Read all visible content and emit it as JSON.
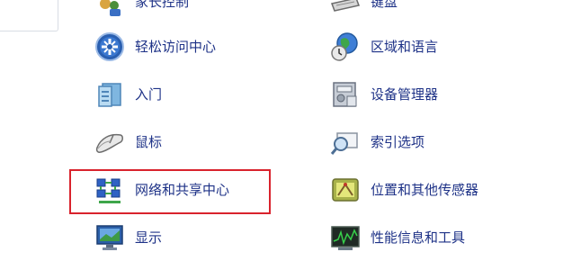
{
  "left_column": [
    {
      "label": "家长控制",
      "icon": "parental-controls-icon"
    },
    {
      "label": "轻松访问中心",
      "icon": "ease-of-access-icon"
    },
    {
      "label": "入门",
      "icon": "getting-started-icon"
    },
    {
      "label": "鼠标",
      "icon": "mouse-icon"
    },
    {
      "label": "网络和共享中心",
      "icon": "network-sharing-icon"
    },
    {
      "label": "显示",
      "icon": "display-icon"
    }
  ],
  "right_column": [
    {
      "label": "键盘",
      "icon": "keyboard-icon"
    },
    {
      "label": "区域和语言",
      "icon": "region-language-icon"
    },
    {
      "label": "设备管理器",
      "icon": "device-manager-icon"
    },
    {
      "label": "索引选项",
      "icon": "indexing-options-icon"
    },
    {
      "label": "位置和其他传感器",
      "icon": "location-sensors-icon"
    },
    {
      "label": "性能信息和工具",
      "icon": "performance-tools-icon"
    }
  ],
  "colors": {
    "link": "#1e3287",
    "highlight_border": "#d9232d"
  }
}
